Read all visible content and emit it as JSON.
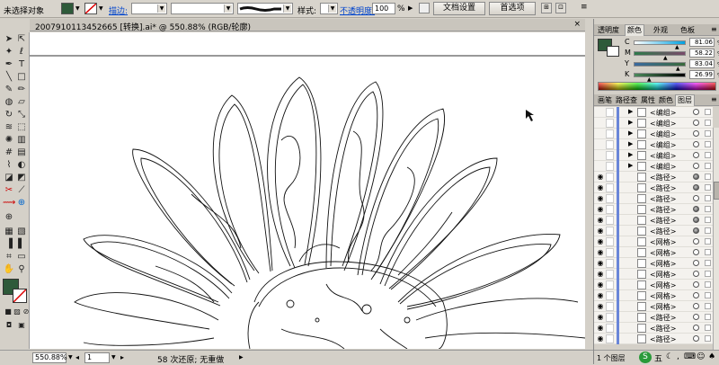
{
  "control_bar": {
    "selection_label": "未选择对象",
    "stroke_label": "描边:",
    "style_label": "样式:",
    "opacity_label": "不透明度:",
    "opacity_value": "100",
    "opacity_unit": "%",
    "doc_setup_button": "文档设置",
    "preferences_button": "首选项",
    "fill_color": "#2e5a3a",
    "accent_link_color": "#0044cc"
  },
  "document": {
    "tab_title": "2007910113452665  [转换].ai* @ 550.88% (RGB/轮廓)",
    "close_glyph": "×"
  },
  "status_bar": {
    "zoom": "550.88%",
    "page": "1",
    "message": "58 次还原; 无重做"
  },
  "color_panel": {
    "tabs": [
      "透明度",
      "颜色",
      "外观",
      "色板"
    ],
    "active_tab": 1,
    "channels": [
      {
        "key": "C",
        "value": "81.06",
        "unit": "%"
      },
      {
        "key": "M",
        "value": "58.22",
        "unit": "%"
      },
      {
        "key": "Y",
        "value": "83.04",
        "unit": "%"
      },
      {
        "key": "K",
        "value": "26.99",
        "unit": "%"
      }
    ],
    "current_color": "#2e5a3a"
  },
  "layers_panel": {
    "tabs": [
      "画笔",
      "路径查",
      "属性",
      "颜色",
      "图层"
    ],
    "active_tab": 4,
    "rows": [
      {
        "name": "<编组>",
        "eye": false,
        "group": true,
        "filled": false
      },
      {
        "name": "<编组>",
        "eye": false,
        "group": true,
        "filled": false
      },
      {
        "name": "<编组>",
        "eye": false,
        "group": true,
        "filled": false
      },
      {
        "name": "<编组>",
        "eye": false,
        "group": true,
        "filled": false
      },
      {
        "name": "<编组>",
        "eye": false,
        "group": true,
        "filled": false
      },
      {
        "name": "<编组>",
        "eye": false,
        "group": true,
        "filled": false
      },
      {
        "name": "<路径>",
        "eye": true,
        "group": false,
        "filled": true
      },
      {
        "name": "<路径>",
        "eye": true,
        "group": false,
        "filled": true
      },
      {
        "name": "<路径>",
        "eye": true,
        "group": false,
        "filled": false
      },
      {
        "name": "<路径>",
        "eye": true,
        "group": false,
        "filled": true
      },
      {
        "name": "<路径>",
        "eye": true,
        "group": false,
        "filled": true
      },
      {
        "name": "<路径>",
        "eye": true,
        "group": false,
        "filled": true
      },
      {
        "name": "<网格>",
        "eye": true,
        "group": false,
        "filled": false
      },
      {
        "name": "<网格>",
        "eye": true,
        "group": false,
        "filled": false
      },
      {
        "name": "<网格>",
        "eye": true,
        "group": false,
        "filled": false
      },
      {
        "name": "<网格>",
        "eye": true,
        "group": false,
        "filled": false
      },
      {
        "name": "<网格>",
        "eye": true,
        "group": false,
        "filled": false
      },
      {
        "name": "<网格>",
        "eye": true,
        "group": false,
        "filled": false
      },
      {
        "name": "<网格>",
        "eye": true,
        "group": false,
        "filled": false
      },
      {
        "name": "<路径>",
        "eye": true,
        "group": false,
        "filled": false
      },
      {
        "name": "<路径>",
        "eye": true,
        "group": false,
        "filled": false
      },
      {
        "name": "<路径>",
        "eye": true,
        "group": false,
        "filled": false
      }
    ],
    "footer_layers": "1 个图层"
  },
  "toolbox": {
    "fill_color": "#2e5a3a"
  }
}
